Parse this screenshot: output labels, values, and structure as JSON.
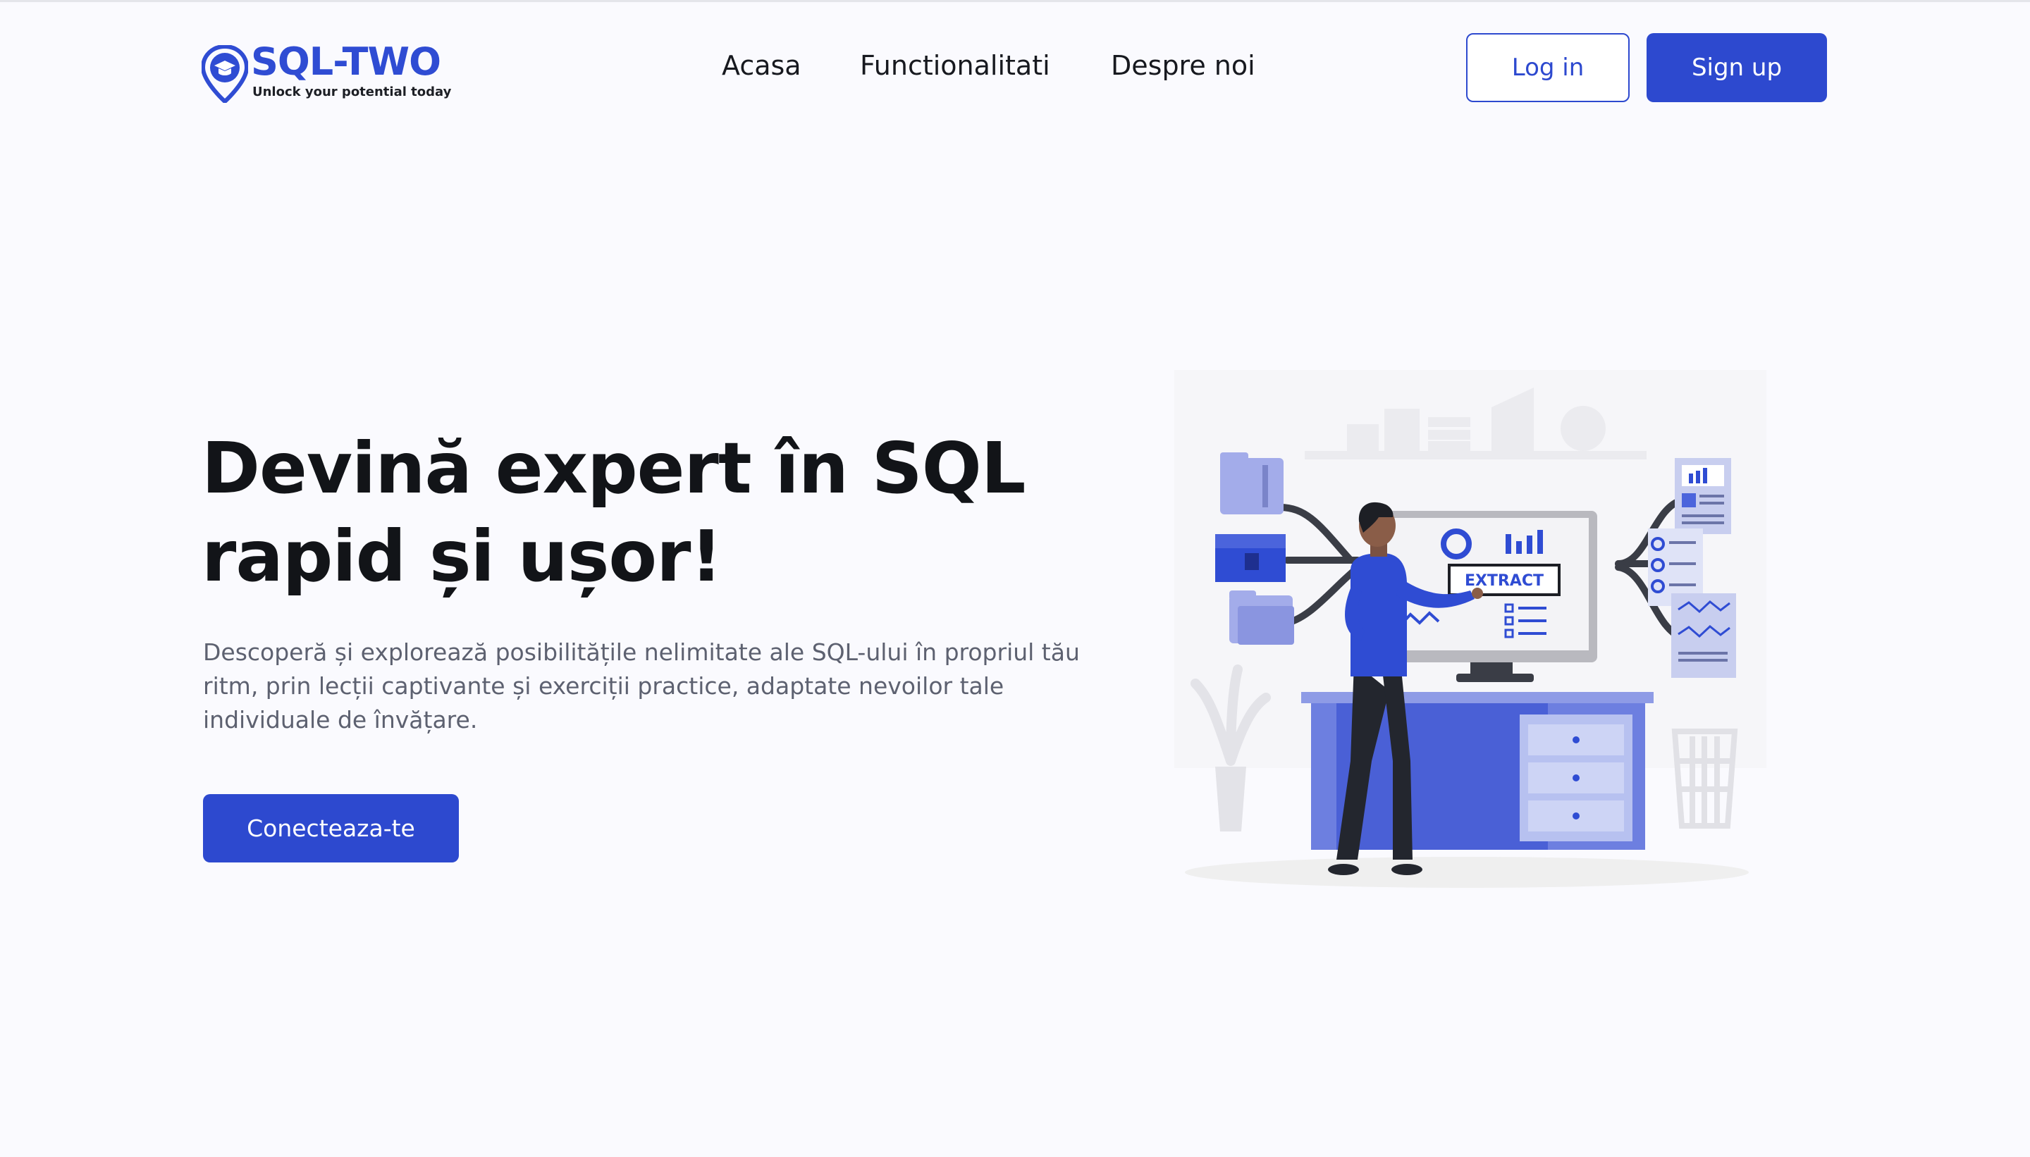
{
  "brand": {
    "name": "SQL-TWO",
    "tagline": "Unlock your potential today",
    "accent": "#2d49cf"
  },
  "nav": {
    "items": [
      {
        "label": "Acasa"
      },
      {
        "label": "Functionalitati"
      },
      {
        "label": "Despre noi"
      }
    ]
  },
  "auth": {
    "login_label": "Log in",
    "signup_label": "Sign up"
  },
  "hero": {
    "title_line1": "Devină expert în SQL",
    "title_line2": "rapid și ușor!",
    "description": "Descoperă și explorează posibilitățile nelimitate ale SQL-ului în propriul tău ritm, prin lecții captivante și exerciții practice, adaptate nevoilor tale individuale de învățare.",
    "cta_label": "Conecteaza-te"
  },
  "illustration": {
    "screen_label": "EXTRACT"
  },
  "colors": {
    "background": "#fafafe",
    "primary": "#2d49cf",
    "text_dark": "#121418",
    "text_muted": "#5d6170"
  }
}
